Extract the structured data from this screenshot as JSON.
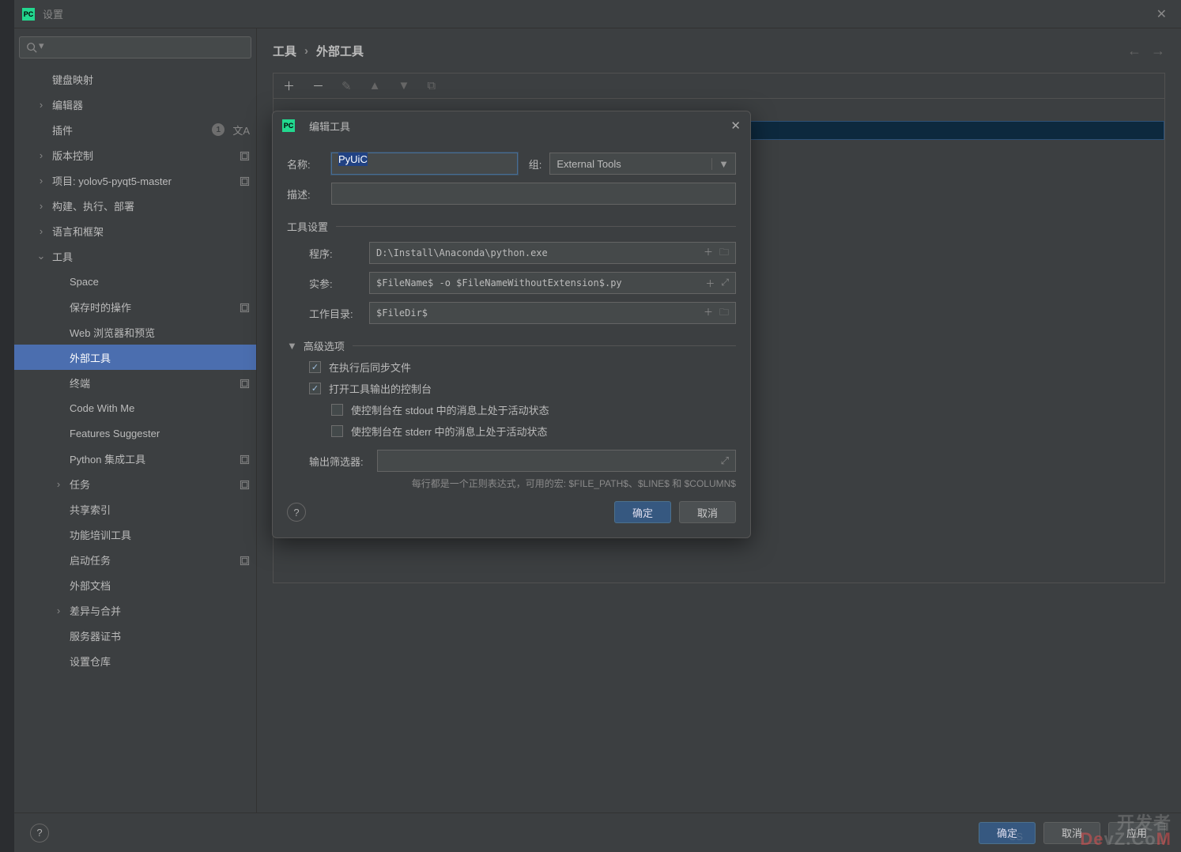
{
  "window": {
    "title": "设置"
  },
  "breadcrumb": {
    "root": "工具",
    "current": "外部工具"
  },
  "sidebar": {
    "items": [
      {
        "label": "键盘映射",
        "expandable": false,
        "level": "top"
      },
      {
        "label": "编辑器",
        "expandable": true,
        "level": "top"
      },
      {
        "label": "插件",
        "expandable": false,
        "level": "top",
        "badge": "1",
        "lang": true
      },
      {
        "label": "版本控制",
        "expandable": true,
        "level": "top",
        "box": true
      },
      {
        "label": "项目: yolov5-pyqt5-master",
        "expandable": true,
        "level": "top",
        "box": true
      },
      {
        "label": "构建、执行、部署",
        "expandable": true,
        "level": "top"
      },
      {
        "label": "语言和框架",
        "expandable": true,
        "level": "top"
      },
      {
        "label": "工具",
        "expandable": true,
        "level": "top",
        "open": true
      },
      {
        "label": "Space",
        "level": "sub"
      },
      {
        "label": "保存时的操作",
        "level": "sub",
        "box": true
      },
      {
        "label": "Web 浏览器和预览",
        "level": "sub"
      },
      {
        "label": "外部工具",
        "level": "sub",
        "selected": true
      },
      {
        "label": "终端",
        "level": "sub",
        "box": true
      },
      {
        "label": "Code With Me",
        "level": "sub"
      },
      {
        "label": "Features Suggester",
        "level": "sub"
      },
      {
        "label": "Python 集成工具",
        "level": "sub",
        "box": true
      },
      {
        "label": "任务",
        "level": "sub",
        "expandable": true,
        "box": true
      },
      {
        "label": "共享索引",
        "level": "sub"
      },
      {
        "label": "功能培训工具",
        "level": "sub"
      },
      {
        "label": "启动任务",
        "level": "sub",
        "box": true
      },
      {
        "label": "外部文档",
        "level": "sub"
      },
      {
        "label": "差异与合并",
        "level": "sub",
        "expandable": true
      },
      {
        "label": "服务器证书",
        "level": "sub"
      },
      {
        "label": "设置仓库",
        "level": "sub"
      }
    ]
  },
  "dialog": {
    "title": "编辑工具",
    "name_label": "名称:",
    "name_value": "PyUiC",
    "group_label": "组:",
    "group_value": "External Tools",
    "desc_label": "描述:",
    "desc_value": "",
    "section_tool": "工具设置",
    "program_label": "程序:",
    "program_value": "D:\\Install\\Anaconda\\python.exe",
    "args_label": "实参:",
    "args_value": "$FileName$ -o $FileNameWithoutExtension$.py",
    "workdir_label": "工作目录:",
    "workdir_value": "$FileDir$",
    "section_adv": "高级选项",
    "chk_sync": "在执行后同步文件",
    "chk_console": "打开工具输出的控制台",
    "chk_stdout": "使控制台在 stdout 中的消息上处于活动状态",
    "chk_stderr": "使控制台在 stderr 中的消息上处于活动状态",
    "output_filter_label": "输出筛选器:",
    "hint": "每行都是一个正则表达式，可用的宏: $FILE_PATH$、$LINE$ 和 $COLUMN$",
    "ok": "确定",
    "cancel": "取消"
  },
  "footer": {
    "ok": "确定",
    "cancel": "取消",
    "apply": "应用"
  },
  "watermark": {
    "line1": "开发者",
    "line2_a": "De",
    "line2_b": "vZ.Co",
    "line2_c": "M"
  },
  "csdn": "CS"
}
